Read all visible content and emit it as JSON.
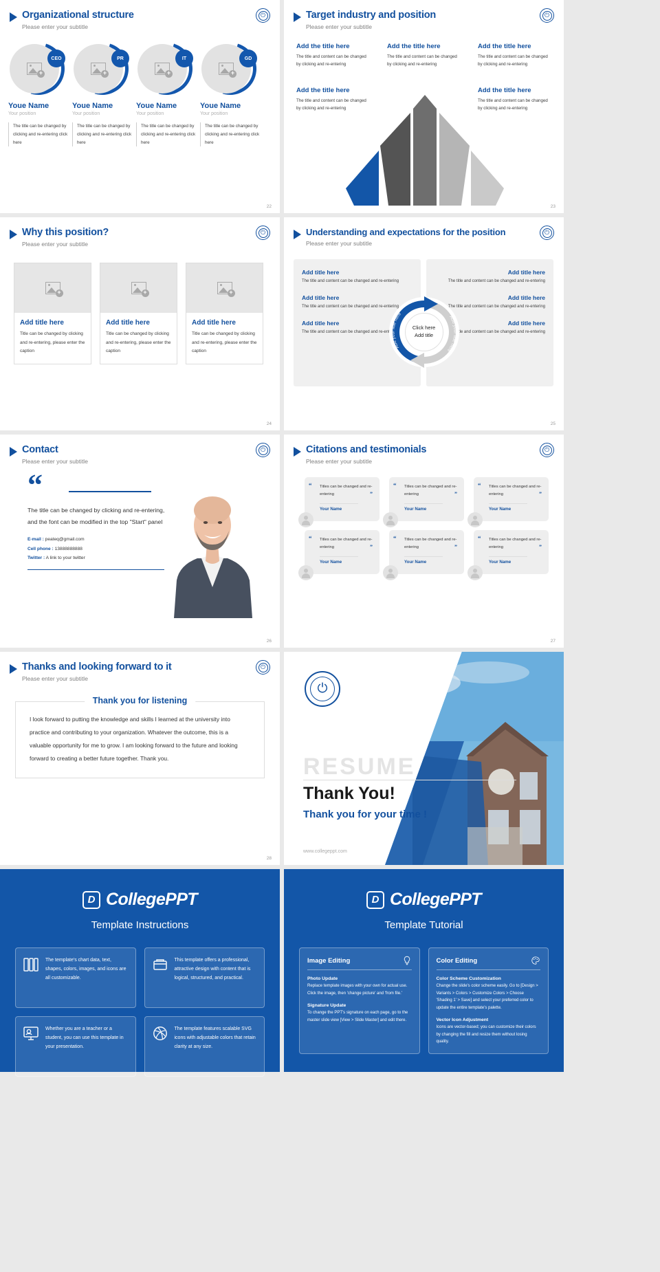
{
  "common": {
    "subtitle": "Please enter your subtitle",
    "logo_icon": "university-seal-icon"
  },
  "slide22": {
    "title": "Organizational structure",
    "page": "22",
    "members": [
      {
        "badge": "CEO",
        "name": "Youe Name",
        "position": "Your position",
        "desc": "The title can be changed by clicking and re-entering click here"
      },
      {
        "badge": "PR",
        "name": "Youe Name",
        "position": "Your position",
        "desc": "The title can be changed by clicking and re-entering click here"
      },
      {
        "badge": "IT",
        "name": "Youe Name",
        "position": "Your position",
        "desc": "The title can be changed by clicking and re-entering click here"
      },
      {
        "badge": "GD",
        "name": "Youe Name",
        "position": "Your position",
        "desc": "The title can be changed by clicking and re-entering click here"
      }
    ]
  },
  "slide23": {
    "title": "Target industry and position",
    "page": "23",
    "items": [
      {
        "title": "Add the title here",
        "body": "The title and content can be changed by clicking and re-entering"
      },
      {
        "title": "Add the title here",
        "body": "The title and content can be changed by clicking and re-entering"
      },
      {
        "title": "Add the title here",
        "body": "The title and content can be changed by clicking and re-entering"
      },
      {
        "title": "Add the title here",
        "body": "The title and content can be changed by clicking and re-entering"
      },
      {
        "title": "Add the title here",
        "body": "The title and content can be changed by clicking and re-entering"
      }
    ]
  },
  "slide24": {
    "title": "Why this position?",
    "page": "24",
    "cards": [
      {
        "title": "Add title here",
        "body": "Title can be changed by clicking and re-entering, please enter the caption"
      },
      {
        "title": "Add title here",
        "body": "Title can be changed by clicking and re-entering, please enter the caption"
      },
      {
        "title": "Add title here",
        "body": "Title can be changed by clicking and re-entering, please enter the caption"
      }
    ]
  },
  "slide25": {
    "title": "Understanding and expectations for the position",
    "page": "25",
    "left": [
      {
        "title": "Add title here",
        "body": "The title and content can be changed and re-entering"
      },
      {
        "title": "Add title here",
        "body": "The title and content can be changed and re-entering"
      },
      {
        "title": "Add title here",
        "body": "The title and content can be changed and re-entering"
      }
    ],
    "right": [
      {
        "title": "Add title here",
        "body": "The title and content can be changed and re-entering"
      },
      {
        "title": "Add title here",
        "body": "The title and content can be changed and re-entering"
      },
      {
        "title": "Add title here",
        "body": "The title and content can be changed and re-entering"
      }
    ],
    "center_line1": "Click here",
    "center_line2": "Add title",
    "arc_left_label": "Add your litle here",
    "arc_right_label": "Add your title here"
  },
  "slide26": {
    "title": "Contact",
    "page": "26",
    "quote_body": "The title can be changed by clicking and re-entering, and the font can be modified in the top \"Start\" panel",
    "email_label": "E-mail :",
    "email_value": "peateq@gmail.com",
    "phone_label": "Cell phone  :",
    "phone_value": "13888888888",
    "twitter_label": "Twitter :",
    "twitter_value": "A link to your twitter"
  },
  "slide27": {
    "title": "Citations and testimonials",
    "page": "27",
    "cards": [
      {
        "text": "Titles can be changed and re-entering",
        "name": "Your Name"
      },
      {
        "text": "Titles can be changed and re-entering",
        "name": "Your Name"
      },
      {
        "text": "Titles can be changed and re-entering",
        "name": "Your Name"
      },
      {
        "text": "Titles can be changed and re-entering",
        "name": "Your Name"
      },
      {
        "text": "Titles can be changed and re-entering",
        "name": "Your Name"
      },
      {
        "text": "Titles can be changed and re-entering",
        "name": "Your Name"
      }
    ]
  },
  "slide28": {
    "title": "Thanks and looking forward to it",
    "page": "28",
    "box_title": "Thank you for listening",
    "box_body": "I look forward to putting the knowledge and skills I learned at the university into practice and contributing to your organization. Whatever the outcome, this is a valuable opportunity for me to grow. I am looking forward to the future and looking forward to creating a better future together. Thank you."
  },
  "slide29": {
    "watermark": "RESUME",
    "thanks": "Thank You!",
    "subthanks": "Thank you for your time !",
    "url": "www.collegeppt.com"
  },
  "instructions": {
    "brand": "CollegePPT",
    "heading": "Template Instructions",
    "cells": [
      {
        "icon": "layers-icon",
        "text": "The template's chart data, text, shapes, colors, images, and icons are all customizable."
      },
      {
        "icon": "box-icon",
        "text": "This template offers a professional, attractive design with content that is logical, structured, and practical."
      },
      {
        "icon": "presenter-icon",
        "text": "Whether you are a teacher or a student, you can use this template in your presentation."
      },
      {
        "icon": "dribbble-icon",
        "text": "The template features scalable SVG icons with adjustable colors that retain clarity at any size."
      }
    ]
  },
  "tutorial": {
    "brand": "CollegePPT",
    "heading": "Template Tutorial",
    "columns": [
      {
        "title": "Image Editing",
        "icon": "lightbulb-icon",
        "items": [
          {
            "title": "Photo Update",
            "body": "Replace template images with your own for actual use. Click the image, then 'change picture' and 'from file.'"
          },
          {
            "title": "Signature Update",
            "body": "To change the PPT's signature on each page, go to the master slide view [View > Slide Master] and edit there."
          }
        ]
      },
      {
        "title": "Color Editing",
        "icon": "palette-icon",
        "items": [
          {
            "title": "Color Scheme Customization",
            "body": "Change the slide's color scheme easily. Go to [Design > Variants > Colors > Customize Colors > Choose 'Shading 1' > Save] and select your preferred color to update the entire template's palette."
          },
          {
            "title": "Vector Icon Adjustment",
            "body": "Icons are vector-based; you can customize their colors by changing the fill and resize them without losing quality."
          }
        ]
      }
    ]
  }
}
